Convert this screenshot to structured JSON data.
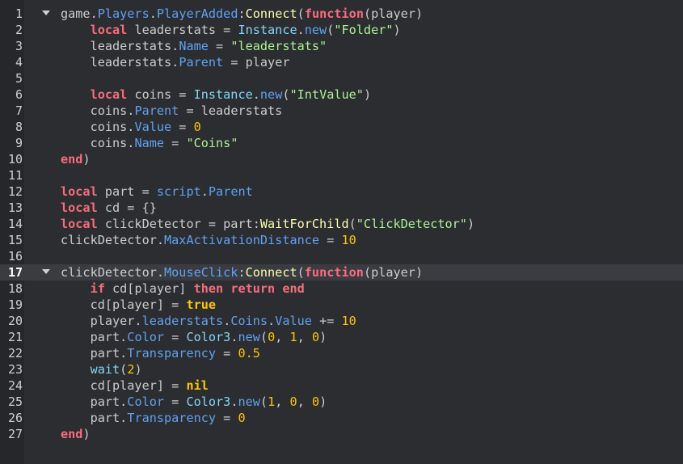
{
  "editor": {
    "colors": {
      "background": "#2b2d31",
      "gutter": "#25272b",
      "current_line": "#3a3c42",
      "keyword": "#f86d7c",
      "member": "#61a1f1",
      "builtin": "#84d6f7",
      "string": "#adf195",
      "number": "#ffc600",
      "method": "#fdfbac",
      "text": "#cccccc"
    },
    "current_line": 17,
    "fold_icon": "chevron-down-icon",
    "lines": [
      {
        "n": "1",
        "fold": true,
        "tokens": [
          [
            "plain",
            "game."
          ],
          [
            "member",
            "Players"
          ],
          [
            "plain",
            "."
          ],
          [
            "member",
            "PlayerAdded"
          ],
          [
            "plain",
            ":"
          ],
          [
            "method",
            "Connect"
          ],
          [
            "plain",
            "("
          ],
          [
            "keyword",
            "function"
          ],
          [
            "plain",
            "(player)"
          ]
        ]
      },
      {
        "n": "2",
        "fold": false,
        "tokens": [
          [
            "plain",
            "    "
          ],
          [
            "keyword",
            "local"
          ],
          [
            "plain",
            " leaderstats = "
          ],
          [
            "builtin",
            "Instance"
          ],
          [
            "plain",
            "."
          ],
          [
            "member",
            "new"
          ],
          [
            "plain",
            "("
          ],
          [
            "string",
            "\"Folder\""
          ],
          [
            "plain",
            ")"
          ]
        ]
      },
      {
        "n": "3",
        "fold": false,
        "tokens": [
          [
            "plain",
            "    leaderstats."
          ],
          [
            "member",
            "Name"
          ],
          [
            "plain",
            " = "
          ],
          [
            "string",
            "\"leaderstats\""
          ]
        ]
      },
      {
        "n": "4",
        "fold": false,
        "tokens": [
          [
            "plain",
            "    leaderstats."
          ],
          [
            "member",
            "Parent"
          ],
          [
            "plain",
            " = player"
          ]
        ]
      },
      {
        "n": "5",
        "fold": false,
        "tokens": []
      },
      {
        "n": "6",
        "fold": false,
        "tokens": [
          [
            "plain",
            "    "
          ],
          [
            "keyword",
            "local"
          ],
          [
            "plain",
            " coins = "
          ],
          [
            "builtin",
            "Instance"
          ],
          [
            "plain",
            "."
          ],
          [
            "member",
            "new"
          ],
          [
            "plain",
            "("
          ],
          [
            "string",
            "\"IntValue\""
          ],
          [
            "plain",
            ")"
          ]
        ]
      },
      {
        "n": "7",
        "fold": false,
        "tokens": [
          [
            "plain",
            "    coins."
          ],
          [
            "member",
            "Parent"
          ],
          [
            "plain",
            " = leaderstats"
          ]
        ]
      },
      {
        "n": "8",
        "fold": false,
        "tokens": [
          [
            "plain",
            "    coins."
          ],
          [
            "member",
            "Value"
          ],
          [
            "plain",
            " = "
          ],
          [
            "number",
            "0"
          ]
        ]
      },
      {
        "n": "9",
        "fold": false,
        "tokens": [
          [
            "plain",
            "    coins."
          ],
          [
            "member",
            "Name"
          ],
          [
            "plain",
            " = "
          ],
          [
            "string",
            "\"Coins\""
          ]
        ]
      },
      {
        "n": "10",
        "fold": false,
        "tokens": [
          [
            "keyword",
            "end"
          ],
          [
            "plain",
            ")"
          ]
        ]
      },
      {
        "n": "11",
        "fold": false,
        "tokens": []
      },
      {
        "n": "12",
        "fold": false,
        "tokens": [
          [
            "keyword",
            "local"
          ],
          [
            "plain",
            " part = "
          ],
          [
            "member",
            "script"
          ],
          [
            "plain",
            "."
          ],
          [
            "member",
            "Parent"
          ]
        ]
      },
      {
        "n": "13",
        "fold": false,
        "tokens": [
          [
            "keyword",
            "local"
          ],
          [
            "plain",
            " cd = {}"
          ]
        ]
      },
      {
        "n": "14",
        "fold": false,
        "tokens": [
          [
            "keyword",
            "local"
          ],
          [
            "plain",
            " clickDetector = part:"
          ],
          [
            "method",
            "WaitForChild"
          ],
          [
            "plain",
            "("
          ],
          [
            "string",
            "\"ClickDetector\""
          ],
          [
            "plain",
            ")"
          ]
        ]
      },
      {
        "n": "15",
        "fold": false,
        "tokens": [
          [
            "plain",
            "clickDetector."
          ],
          [
            "member",
            "MaxActivationDistance"
          ],
          [
            "plain",
            " = "
          ],
          [
            "number",
            "10"
          ]
        ]
      },
      {
        "n": "16",
        "fold": false,
        "tokens": []
      },
      {
        "n": "17",
        "fold": true,
        "tokens": [
          [
            "plain",
            "clickDetector."
          ],
          [
            "member",
            "MouseClick"
          ],
          [
            "plain",
            ":"
          ],
          [
            "method",
            "Connect"
          ],
          [
            "plain",
            "("
          ],
          [
            "keyword",
            "function"
          ],
          [
            "plain",
            "(player)"
          ]
        ]
      },
      {
        "n": "18",
        "fold": false,
        "tokens": [
          [
            "plain",
            "    "
          ],
          [
            "keyword",
            "if"
          ],
          [
            "plain",
            " cd[player] "
          ],
          [
            "keyword",
            "then"
          ],
          [
            "plain",
            " "
          ],
          [
            "keyword",
            "return"
          ],
          [
            "plain",
            " "
          ],
          [
            "keyword",
            "end"
          ]
        ]
      },
      {
        "n": "19",
        "fold": false,
        "tokens": [
          [
            "plain",
            "    cd[player] = "
          ],
          [
            "bool",
            "true"
          ]
        ]
      },
      {
        "n": "20",
        "fold": false,
        "tokens": [
          [
            "plain",
            "    player."
          ],
          [
            "member",
            "leaderstats"
          ],
          [
            "plain",
            "."
          ],
          [
            "member",
            "Coins"
          ],
          [
            "plain",
            "."
          ],
          [
            "member",
            "Value"
          ],
          [
            "plain",
            " += "
          ],
          [
            "number",
            "10"
          ]
        ]
      },
      {
        "n": "21",
        "fold": false,
        "tokens": [
          [
            "plain",
            "    part."
          ],
          [
            "member",
            "Color"
          ],
          [
            "plain",
            " = "
          ],
          [
            "builtin",
            "Color3"
          ],
          [
            "plain",
            "."
          ],
          [
            "member",
            "new"
          ],
          [
            "plain",
            "("
          ],
          [
            "number",
            "0"
          ],
          [
            "plain",
            ", "
          ],
          [
            "number",
            "1"
          ],
          [
            "plain",
            ", "
          ],
          [
            "number",
            "0"
          ],
          [
            "plain",
            ")"
          ]
        ]
      },
      {
        "n": "22",
        "fold": false,
        "tokens": [
          [
            "plain",
            "    part."
          ],
          [
            "member",
            "Transparency"
          ],
          [
            "plain",
            " = "
          ],
          [
            "number",
            "0.5"
          ]
        ]
      },
      {
        "n": "23",
        "fold": false,
        "tokens": [
          [
            "plain",
            "    "
          ],
          [
            "builtin",
            "wait"
          ],
          [
            "plain",
            "("
          ],
          [
            "number",
            "2"
          ],
          [
            "plain",
            ")"
          ]
        ]
      },
      {
        "n": "24",
        "fold": false,
        "tokens": [
          [
            "plain",
            "    cd[player] = "
          ],
          [
            "bool",
            "nil"
          ]
        ]
      },
      {
        "n": "25",
        "fold": false,
        "tokens": [
          [
            "plain",
            "    part."
          ],
          [
            "member",
            "Color"
          ],
          [
            "plain",
            " = "
          ],
          [
            "builtin",
            "Color3"
          ],
          [
            "plain",
            "."
          ],
          [
            "member",
            "new"
          ],
          [
            "plain",
            "("
          ],
          [
            "number",
            "1"
          ],
          [
            "plain",
            ", "
          ],
          [
            "number",
            "0"
          ],
          [
            "plain",
            ", "
          ],
          [
            "number",
            "0"
          ],
          [
            "plain",
            ")"
          ]
        ]
      },
      {
        "n": "26",
        "fold": false,
        "tokens": [
          [
            "plain",
            "    part."
          ],
          [
            "member",
            "Transparency"
          ],
          [
            "plain",
            " = "
          ],
          [
            "number",
            "0"
          ]
        ]
      },
      {
        "n": "27",
        "fold": false,
        "tokens": [
          [
            "keyword",
            "end"
          ],
          [
            "plain",
            ")"
          ]
        ]
      }
    ]
  }
}
